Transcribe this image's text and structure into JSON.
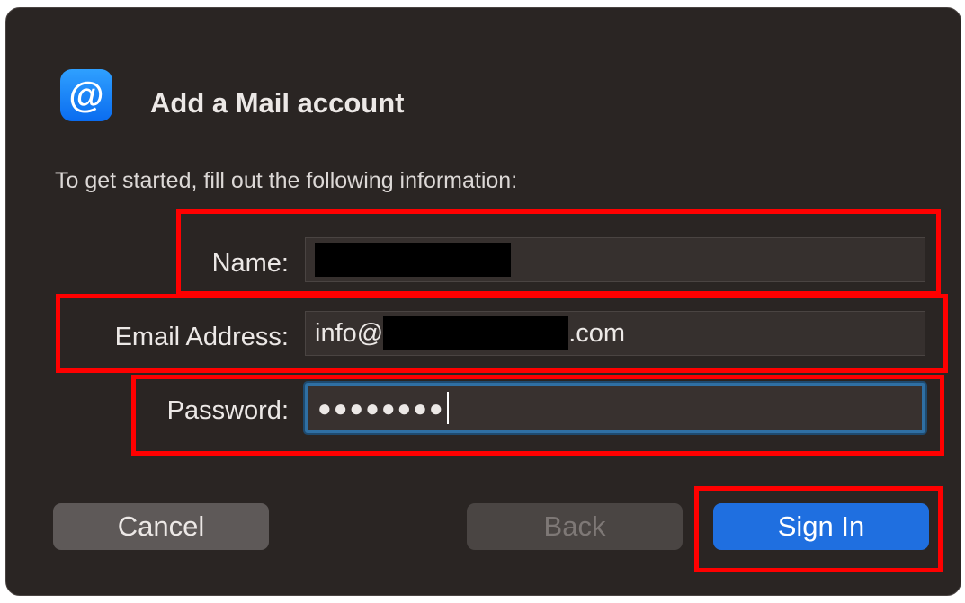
{
  "dialog": {
    "icon": "at-sign-icon",
    "icon_glyph": "@",
    "title": "Add a Mail account",
    "subtitle": "To get started, fill out the following information:"
  },
  "form": {
    "name_label": "Name:",
    "name_value": "",
    "email_label": "Email Address:",
    "email_prefix": "info@",
    "email_suffix": ".com",
    "password_label": "Password:",
    "password_mask": "●●●●●●●●"
  },
  "buttons": {
    "cancel": "Cancel",
    "back": "Back",
    "sign_in": "Sign In"
  },
  "colors": {
    "accent": "#1f6fe0",
    "highlight": "#ff0000",
    "focus_ring": "#2f6fa3"
  }
}
